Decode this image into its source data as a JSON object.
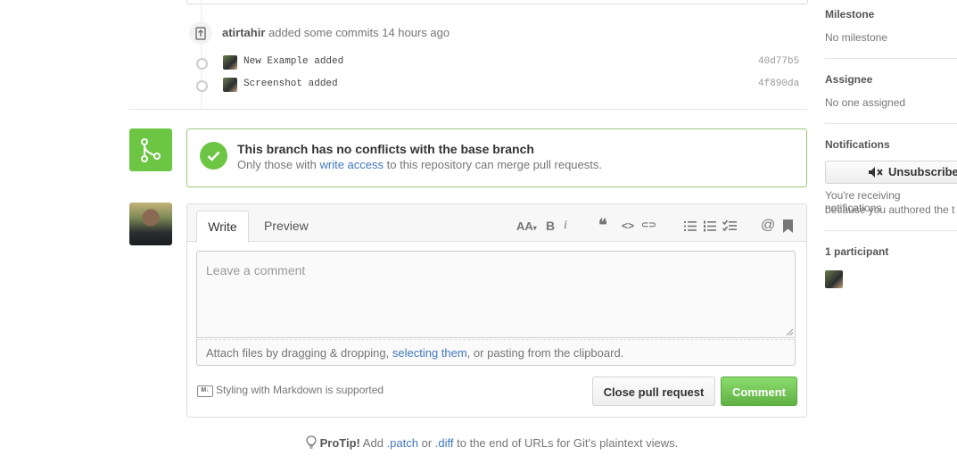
{
  "timeline": {
    "event_user": "atirtahir",
    "event_action": "added some commits",
    "event_time": "14 hours ago",
    "commits": [
      {
        "message": "New Example added",
        "sha": "40d77b5"
      },
      {
        "message": "Screenshot added",
        "sha": "4f890da"
      }
    ]
  },
  "merge": {
    "title": "This branch has no conflicts with the base branch",
    "sub_before": "Only those with",
    "sub_link": "write access",
    "sub_after": "to this repository can merge pull requests."
  },
  "form": {
    "tab_write": "Write",
    "tab_preview": "Preview",
    "toolbar": {
      "header": "AA",
      "bold": "B",
      "italic": "i",
      "quote": "❝",
      "code": "<>",
      "link": "⊂⊃",
      "mention": "@"
    },
    "placeholder": "Leave a comment",
    "attach_before": "Attach files by dragging & dropping,",
    "attach_link": "selecting them",
    "attach_after": ", or pasting from the clipboard.",
    "markdown_badge": "M↓",
    "markdown_note": "Styling with Markdown is supported",
    "close_button": "Close pull request",
    "comment_button": "Comment"
  },
  "protip": {
    "label": "ProTip!",
    "text1": "Add",
    "patch": ".patch",
    "or": "or",
    "diff": ".diff",
    "text2": "to the end of URLs for Git's plaintext views."
  },
  "sidebar": {
    "milestone_label": "Milestone",
    "milestone_value": "No milestone",
    "assignee_label": "Assignee",
    "assignee_value": "No one assigned",
    "notifications_label": "Notifications",
    "unsubscribe_label": "Unsubscribe",
    "notifications_line1": "You're receiving notifications",
    "notifications_line2": "because you authored the t",
    "participants_label": "1 participant"
  },
  "colors": {
    "accent_green": "#6cc644",
    "link_blue": "#4078c0"
  },
  "icons": [
    "push-icon",
    "commit-icon",
    "merge-branch-icon",
    "check-icon",
    "bold-icon",
    "italic-icon",
    "quote-icon",
    "code-icon",
    "link-icon",
    "unordered-list-icon",
    "ordered-list-icon",
    "task-list-icon",
    "mention-icon",
    "bookmark-icon",
    "markdown-icon",
    "lightbulb-icon",
    "mute-icon"
  ]
}
